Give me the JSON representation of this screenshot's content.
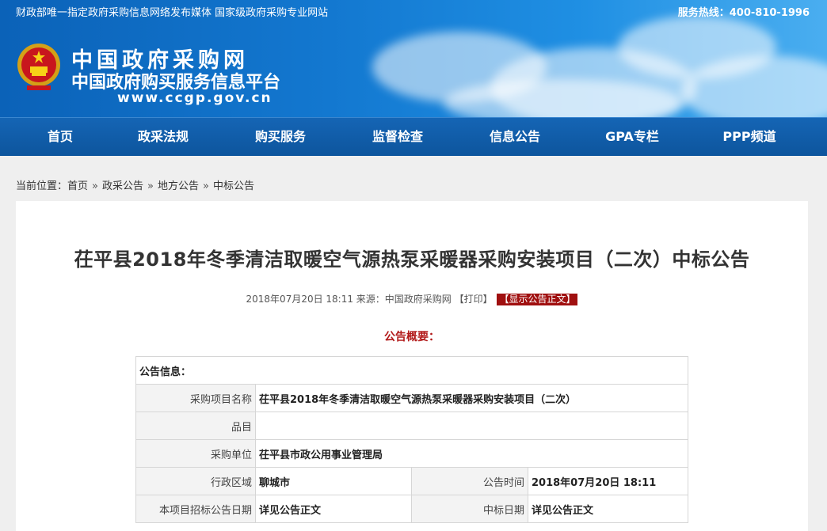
{
  "top_strip": {
    "tagline": "财政部唯一指定政府采购信息网络发布媒体 国家级政府采购专业网站",
    "hotline": "服务热线：400-810-1996"
  },
  "logo": {
    "line1": "中国政府采购网",
    "line2": "中国政府购买服务信息平台",
    "url": "www.ccgp.gov.cn"
  },
  "nav": {
    "items": [
      "首页",
      "政采法规",
      "购买服务",
      "监督检查",
      "信息公告",
      "GPA专栏",
      "PPP频道"
    ]
  },
  "breadcrumb": {
    "prefix": "当前位置：",
    "items": [
      "首页",
      "政采公告",
      "地方公告",
      "中标公告"
    ],
    "separator": "»"
  },
  "article": {
    "title": "茌平县2018年冬季清洁取暖空气源热泵采暖器采购安装项目（二次）中标公告",
    "meta_text": "2018年07月20日 18:11 来源：中国政府采购网 【打印】",
    "show_text_button": "【显示公告正文】",
    "summary_heading": "公告概要："
  },
  "info_table": {
    "header": "公告信息：",
    "rows": {
      "project_name_label": "采购项目名称",
      "project_name_value": "茌平县2018年冬季清洁取暖空气源热泵采暖器采购安装项目（二次）",
      "item_label": "品目",
      "item_value": "",
      "unit_label": "采购单位",
      "unit_value": "茌平县市政公用事业管理局",
      "region_label": "行政区域",
      "region_value": "聊城市",
      "notice_time_label": "公告时间",
      "notice_time_value": "2018年07月20日 18:11",
      "bid_date_label": "本项目招标公告日期",
      "bid_date_value": "详见公告正文",
      "award_date_label": "中标日期",
      "award_date_value": "详见公告正文"
    }
  },
  "colors": {
    "banner_blue": "#1378d0",
    "nav_blue": "#0d559d",
    "accent_red": "#b21a1a"
  }
}
